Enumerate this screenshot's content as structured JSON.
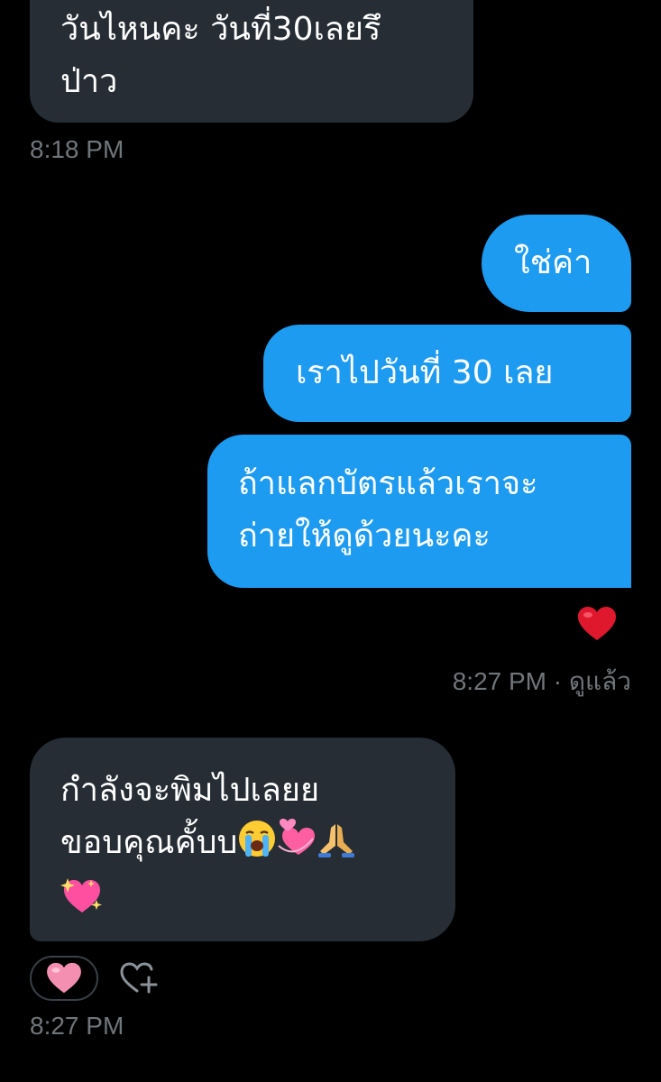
{
  "colors": {
    "background": "#000000",
    "incoming_bubble": "#262d34",
    "outgoing_bubble": "#1d9bf0",
    "timestamp": "#71767b",
    "heart_red": "#e0182e",
    "heart_pink": "#f48fb1"
  },
  "messages": {
    "msg1": {
      "line1": "วันไหนคะ วันที่30เลยรึ",
      "line2": "ป่าว",
      "time": "8:18 PM"
    },
    "msg2": {
      "text": "ใช่ค่า"
    },
    "msg3": {
      "text": "เราไปวันที่ 30 เลย"
    },
    "msg4": {
      "line1": "ถ้าแลกบัตรแล้วเราจะ",
      "line2": "ถ่ายให้ดูด้วยนะคะ",
      "reaction_icon": "red-heart-icon",
      "time": "8:27 PM · ดูแล้ว"
    },
    "msg5": {
      "line1": "กำลังจะพิมไปเลยย",
      "line2_text": "ขอบคุณคั้บบ",
      "line2_emojis": [
        "loudly-crying-face-icon",
        "revolving-hearts-icon",
        "folded-hands-icon"
      ],
      "line3_emojis": [
        "sparkling-heart-icon"
      ],
      "reaction_icon": "pink-heart-icon",
      "add_reaction_icon": "add-reaction-icon",
      "time": "8:27 PM"
    }
  }
}
